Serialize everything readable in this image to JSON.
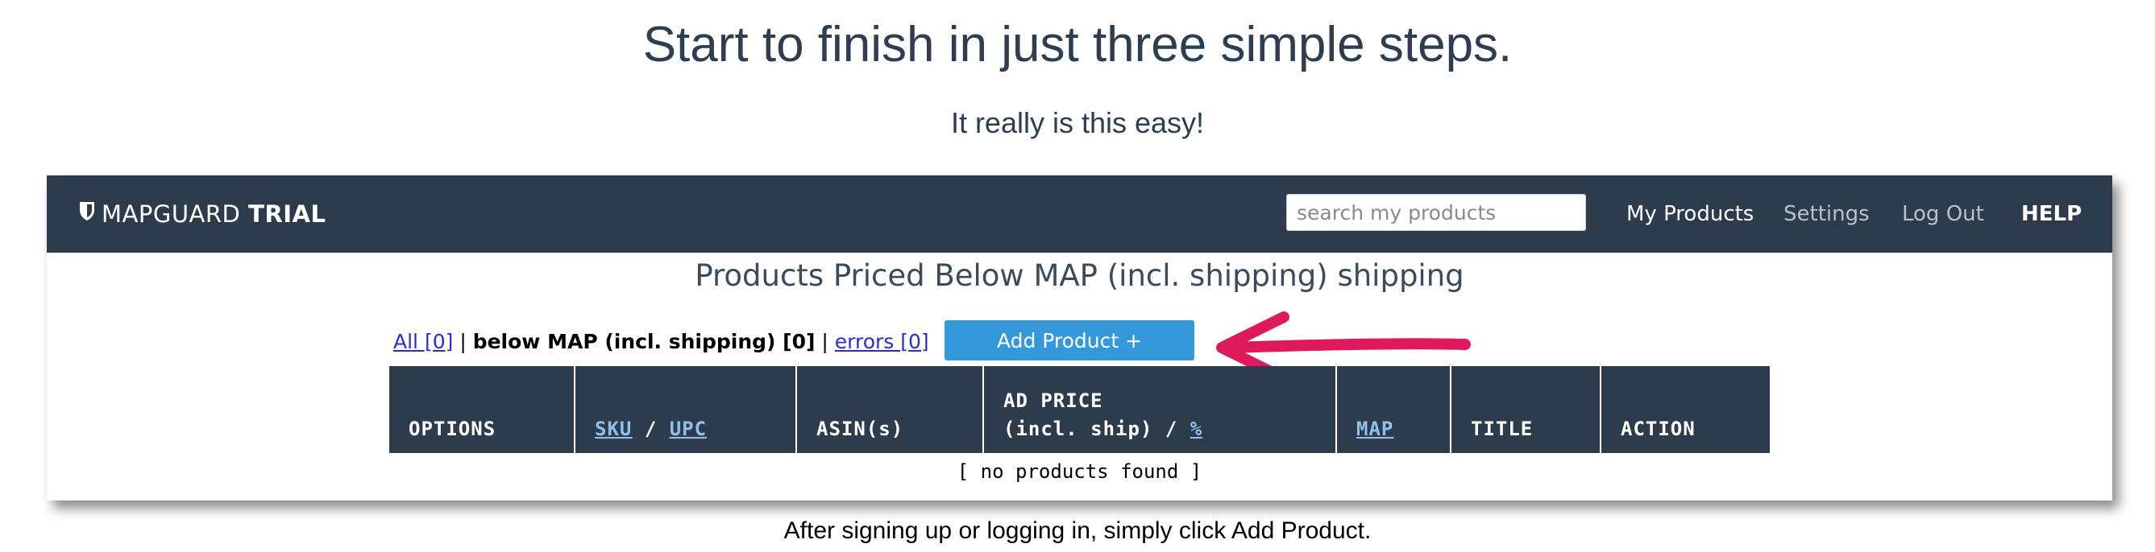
{
  "headline": "Start to finish in just three simple steps.",
  "subheadline": "It really is this easy!",
  "app": {
    "brand": {
      "name": "MAPGUARD",
      "tier": "TRIAL",
      "icon": "shield-icon"
    },
    "search": {
      "placeholder": "search my products",
      "value": ""
    },
    "nav": {
      "my_products": "My Products",
      "settings": "Settings",
      "logout": "Log Out",
      "help": "HELP"
    },
    "page_title": "Products Priced Below MAP (incl. shipping) shipping",
    "filters": {
      "all": "All [0]",
      "separator": "|",
      "below_map": "below MAP (incl. shipping) [0]",
      "errors": "errors [0]"
    },
    "add_button": "Add Product +",
    "table": {
      "options": "OPTIONS",
      "sku": "SKU",
      "slash": "/",
      "upc": "UPC",
      "asin": "ASIN(s)",
      "ad_price_line1": "AD PRICE",
      "ad_price_line2": "(incl. ship) /",
      "percent": "%",
      "map": "MAP",
      "title": "TITLE",
      "action": "ACTION",
      "empty": "[ no products found ]"
    }
  },
  "caption": "After signing up or logging in, simply click Add Product.",
  "colors": {
    "navbar": "#2d3c4d",
    "accent_button": "#3498db",
    "annotation_arrow": "#e0195c",
    "link": "#2b2bd6"
  }
}
